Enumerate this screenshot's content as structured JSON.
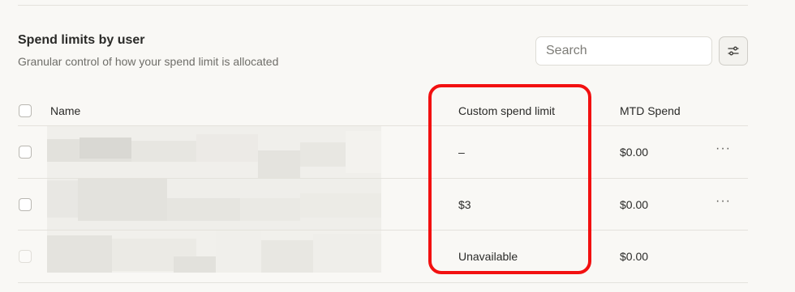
{
  "section": {
    "title": "Spend limits by user",
    "subtitle": "Granular control of how your spend limit is allocated"
  },
  "search": {
    "placeholder": "Search"
  },
  "icons": {
    "filter": "sliders-icon",
    "more": "more-horizontal-icon"
  },
  "table": {
    "headers": {
      "name": "Name",
      "limit": "Custom spend limit",
      "mtd": "MTD Spend"
    },
    "rows": [
      {
        "limit": "–",
        "mtd": "$0.00",
        "more": "···"
      },
      {
        "limit": "$3",
        "mtd": "$0.00",
        "more": "···"
      },
      {
        "limit": "Unavailable",
        "mtd": "$0.00"
      }
    ]
  },
  "colors": {
    "highlight": "#f21010",
    "background": "#f9f8f5"
  }
}
